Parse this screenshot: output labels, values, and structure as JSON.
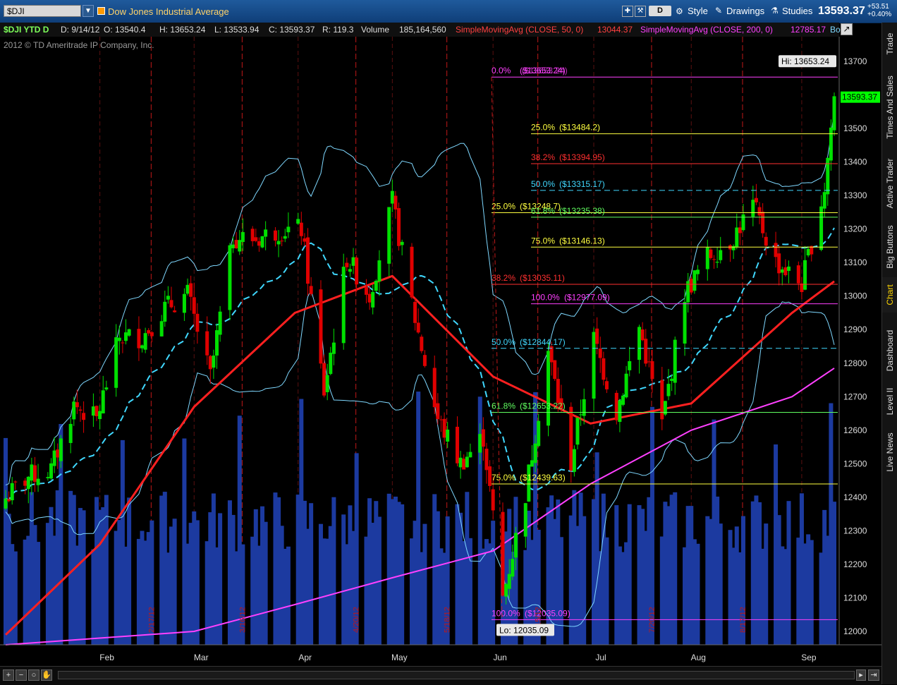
{
  "header": {
    "symbol": "$DJI",
    "description": "Dow Jones Industrial Average",
    "aggregation": "D",
    "style_label": "Style",
    "drawings_label": "Drawings",
    "studies_label": "Studies",
    "last_price": "13593.37",
    "net_change": "+53.51",
    "pct_change": "+0.40%"
  },
  "infobar": {
    "symbol_period": "$DJI YTD D",
    "date": "D: 9/14/12",
    "open": "O: 13540.4",
    "high": "H: 13653.24",
    "low": "L: 13533.94",
    "close": "C: 13593.37",
    "range": "R: 119.3",
    "volume_label": "Volume",
    "volume_value": "185,164,560",
    "sma50_label": "SimpleMovingAvg (CLOSE, 50, 0)",
    "sma50_value": "13044.37",
    "sma200_label": "SimpleMovingAvg (CLOSE, 200, 0)",
    "sma200_value": "12785.17",
    "trailing": "Bo"
  },
  "copyright": "2012 © TD Ameritrade IP Company, Inc.",
  "right_tabs": [
    "Trade",
    "Times And Sales",
    "Active Trader",
    "Big Buttons",
    "Chart",
    "Dashboard",
    "Level II",
    "Live News"
  ],
  "active_tab": "Chart",
  "colors": {
    "up_candle": "#00e000",
    "down_candle": "#e00000",
    "sma50": "#ff2020",
    "sma200": "#ff40ff",
    "bollinger": "#7fd8ff",
    "ema_dashed": "#40d8ff",
    "volume": "#1c3aa0",
    "last_price_tag": "#00ff00"
  },
  "chart_data": {
    "type": "candlestick",
    "y_ticks": [
      12000,
      12100,
      12200,
      12300,
      12400,
      12500,
      12600,
      12700,
      12800,
      12900,
      13000,
      13100,
      13200,
      13300,
      13400,
      13500,
      13600,
      13700
    ],
    "ylim": [
      11960,
      13740
    ],
    "x_months": [
      "Feb",
      "Mar",
      "Apr",
      "May",
      "Jun",
      "Jul",
      "Aug",
      "Sep"
    ],
    "date_markers": [
      "2/17/12",
      "3/16/12",
      "4/20/12",
      "5/18/12",
      "6/15/12",
      "7/20/12",
      "8/17/12"
    ],
    "hi_label": "Hi: 13653.24",
    "lo_label": "Lo: 12035.09",
    "last_tag": "13593.37",
    "close_path": [
      [
        "1/3/12",
        12397
      ],
      [
        "1/10/12",
        12462
      ],
      [
        "1/17/12",
        12482
      ],
      [
        "1/24/12",
        12675
      ],
      [
        "1/31/12",
        12632
      ],
      [
        "2/7/12",
        12878
      ],
      [
        "2/14/12",
        12878
      ],
      [
        "2/21/12",
        12965
      ],
      [
        "2/28/12",
        13005
      ],
      [
        "3/6/12",
        12759
      ],
      [
        "3/13/12",
        13177
      ],
      [
        "3/20/12",
        13170
      ],
      [
        "3/27/12",
        13197
      ],
      [
        "4/3/12",
        13199
      ],
      [
        "4/10/12",
        12715
      ],
      [
        "4/17/12",
        13115
      ],
      [
        "4/24/12",
        13001
      ],
      [
        "5/1/12",
        13279
      ],
      [
        "5/8/12",
        12932
      ],
      [
        "5/15/12",
        12632
      ],
      [
        "5/22/12",
        12502
      ],
      [
        "5/29/12",
        12580
      ],
      [
        "6/4/12",
        12101
      ],
      [
        "6/11/12",
        12411
      ],
      [
        "6/18/12",
        12837
      ],
      [
        "6/25/12",
        12502
      ],
      [
        "7/2/12",
        12871
      ],
      [
        "7/9/12",
        12653
      ],
      [
        "7/16/12",
        12908
      ],
      [
        "7/23/12",
        12617
      ],
      [
        "7/30/12",
        13008
      ],
      [
        "8/6/12",
        13117
      ],
      [
        "8/13/12",
        13164
      ],
      [
        "8/20/12",
        13271
      ],
      [
        "8/27/12",
        13102
      ],
      [
        "9/4/12",
        13035
      ],
      [
        "9/11/12",
        13323
      ],
      [
        "9/14/12",
        13593
      ]
    ],
    "sma50": [
      [
        "1/3/12",
        11990
      ],
      [
        "2/1/12",
        12260
      ],
      [
        "3/1/12",
        12670
      ],
      [
        "4/1/12",
        12950
      ],
      [
        "5/1/12",
        13060
      ],
      [
        "6/1/12",
        12760
      ],
      [
        "7/1/12",
        12620
      ],
      [
        "8/1/12",
        12680
      ],
      [
        "9/1/12",
        12950
      ],
      [
        "9/14/12",
        13044
      ]
    ],
    "sma200": [
      [
        "1/3/12",
        11960
      ],
      [
        "3/1/12",
        12000
      ],
      [
        "4/1/12",
        12080
      ],
      [
        "5/1/12",
        12160
      ],
      [
        "6/1/12",
        12240
      ],
      [
        "7/1/12",
        12440
      ],
      [
        "8/1/12",
        12600
      ],
      [
        "9/1/12",
        12700
      ],
      [
        "9/14/12",
        12785
      ]
    ],
    "fib_sets": [
      {
        "name": "primary",
        "levels": [
          {
            "label": "0.0%",
            "price": 13653.24,
            "color": "#ff40ff"
          },
          {
            "label": "25.0%",
            "price": 13248.7,
            "color": "#ffff40"
          },
          {
            "label": "38.2%",
            "price": 13035.11,
            "color": "#ff3030"
          },
          {
            "label": "50.0%",
            "price": 12844.17,
            "color": "#40d8ff",
            "dashed": true
          },
          {
            "label": "61.8%",
            "price": 12653.22,
            "color": "#60ff60"
          },
          {
            "label": "75.0%",
            "price": 12439.63,
            "color": "#ffff40"
          },
          {
            "label": "100.0%",
            "price": 12035.09,
            "color": "#ff40ff"
          }
        ]
      },
      {
        "name": "secondary",
        "levels": [
          {
            "label": "25.0%",
            "price": 13484.2,
            "color": "#ffff40"
          },
          {
            "label": "38.2%",
            "price": 13394.95,
            "color": "#ff3030"
          },
          {
            "label": "50.0%",
            "price": 13315.17,
            "color": "#40d8ff",
            "dashed": true
          },
          {
            "label": "61.8%",
            "price": 13235.38,
            "color": "#60ff60"
          },
          {
            "label": "75.0%",
            "price": 13146.13,
            "color": "#ffff40"
          },
          {
            "label": "100.0%",
            "price": 12977.09,
            "color": "#ff40ff"
          }
        ]
      }
    ],
    "ghost_label": "($13653.24)",
    "grid": false
  }
}
